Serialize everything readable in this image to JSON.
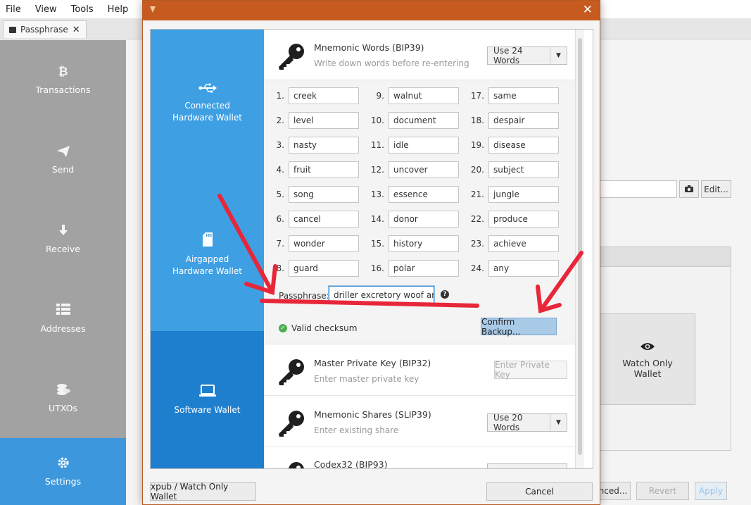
{
  "menu": {
    "file": "File",
    "view": "View",
    "tools": "Tools",
    "help": "Help"
  },
  "tab": {
    "label": "Passphrase",
    "close": "✕"
  },
  "nav": [
    {
      "label": "Transactions",
      "icon": "bitcoin-icon"
    },
    {
      "label": "Send",
      "icon": "send-icon"
    },
    {
      "label": "Receive",
      "icon": "receive-icon"
    },
    {
      "label": "Addresses",
      "icon": "addresses-icon"
    },
    {
      "label": "UTXOs",
      "icon": "utxos-icon"
    },
    {
      "label": "Settings",
      "icon": "settings-icon",
      "active": true
    }
  ],
  "background": {
    "edit_label": "Edit...",
    "watch_only_card": "Watch Only Wallet",
    "advanced_label": "nced...",
    "revert_label": "Revert",
    "apply_label": "Apply"
  },
  "dialog": {
    "close": "✕",
    "sidebar": {
      "connected": "Connected Hardware Wallet",
      "airgapped": "Airgapped Hardware Wallet",
      "software": "Software Wallet"
    },
    "bip39": {
      "title": "Mnemonic Words (BIP39)",
      "subtitle": "Write down words before re-entering",
      "dropdown": "Use 24 Words"
    },
    "words": [
      "creek",
      "level",
      "nasty",
      "fruit",
      "song",
      "cancel",
      "wonder",
      "guard",
      "walnut",
      "document",
      "idle",
      "uncover",
      "essence",
      "donor",
      "history",
      "polar",
      "same",
      "despair",
      "disease",
      "subject",
      "jungle",
      "produce",
      "achieve",
      "any"
    ],
    "passphrase": {
      "label": "Passphrase:",
      "value": "driller excretory woof argu"
    },
    "checksum": "Valid checksum",
    "confirm_backup": "Confirm Backup...",
    "bip32": {
      "title": "Master Private Key (BIP32)",
      "subtitle": "Enter master private key",
      "button": "Enter Private Key"
    },
    "slip39": {
      "title": "Mnemonic Shares (SLIP39)",
      "subtitle": "Enter existing share",
      "dropdown": "Use 20 Words"
    },
    "codex32": {
      "title": "Codex32 (BIP93)"
    },
    "footer": {
      "xpub": "xpub / Watch Only Wallet",
      "cancel": "Cancel"
    }
  },
  "colors": {
    "titlebar": "#c75b1f",
    "sidebar": "#3e9fe3",
    "sidebar_active": "#1f7fcf",
    "nav_active": "#3d97dd",
    "annotation": "#e8263a",
    "valid": "#4fae4f"
  }
}
